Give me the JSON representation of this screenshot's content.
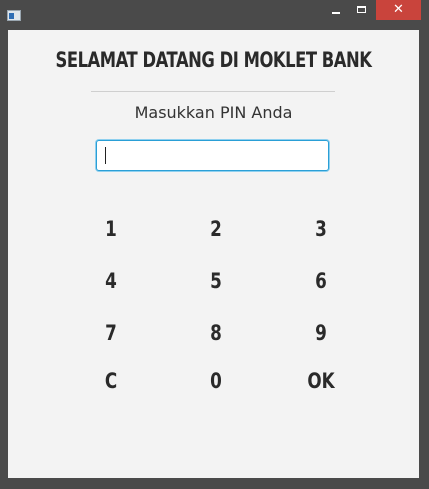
{
  "window": {
    "close_glyph": "✕",
    "accent_close": "#c9443c"
  },
  "main": {
    "title": "SELAMAT DATANG DI MOKLET BANK",
    "prompt": "Masukkan PIN Anda",
    "pin_value": ""
  },
  "keypad": {
    "keys": [
      "1",
      "2",
      "3",
      "4",
      "5",
      "6",
      "7",
      "8",
      "9",
      "C",
      "0",
      "OK"
    ]
  }
}
